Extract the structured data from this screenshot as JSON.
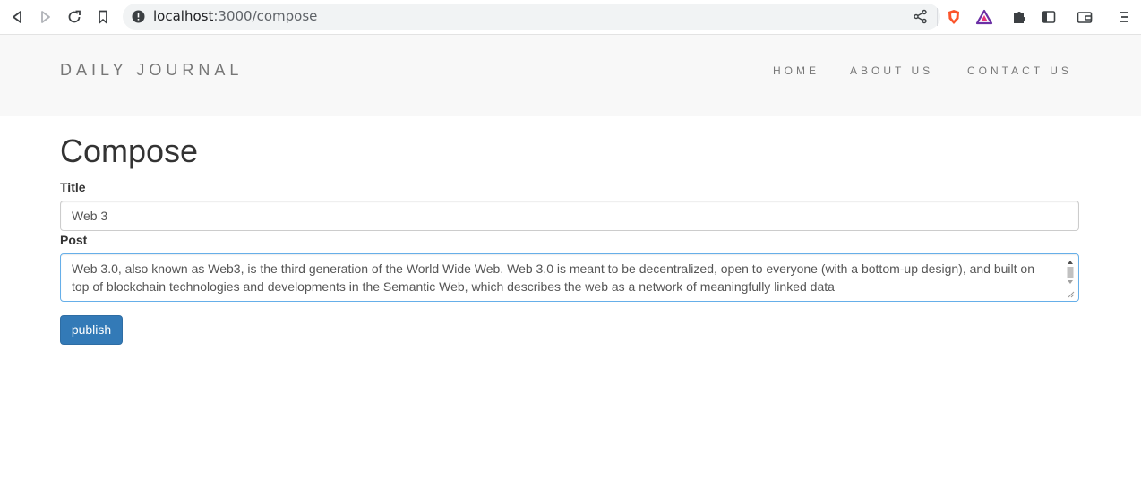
{
  "browser": {
    "url_host": "localhost",
    "url_path": ":3000/compose",
    "icons": [
      "back-icon",
      "forward-icon",
      "reload-icon",
      "bookmark-icon",
      "site-info-icon",
      "share-icon",
      "brave-shields-icon",
      "brave-rewards-icon",
      "extensions-icon",
      "sidebar-icon",
      "wallet-icon",
      "menu-icon"
    ]
  },
  "navbar": {
    "brand": "DAILY JOURNAL",
    "links": [
      "HOME",
      "ABOUT US",
      "CONTACT US"
    ]
  },
  "compose": {
    "heading": "Compose",
    "title_label": "Title",
    "title_value": "Web 3",
    "post_label": "Post",
    "post_value": "Web 3.0, also known as Web3, is the third generation of the World Wide Web. Web 3.0 is meant to be decentralized, open to everyone (with a bottom-up design), and built on top of blockchain technologies and developments in the Semantic Web, which describes the web as a network of meaningfully linked data",
    "publish_label": "publish"
  },
  "colors": {
    "navbar_bg": "#f8f8f8",
    "button_bg": "#337ab7",
    "brave_orange": "#fb542b"
  }
}
